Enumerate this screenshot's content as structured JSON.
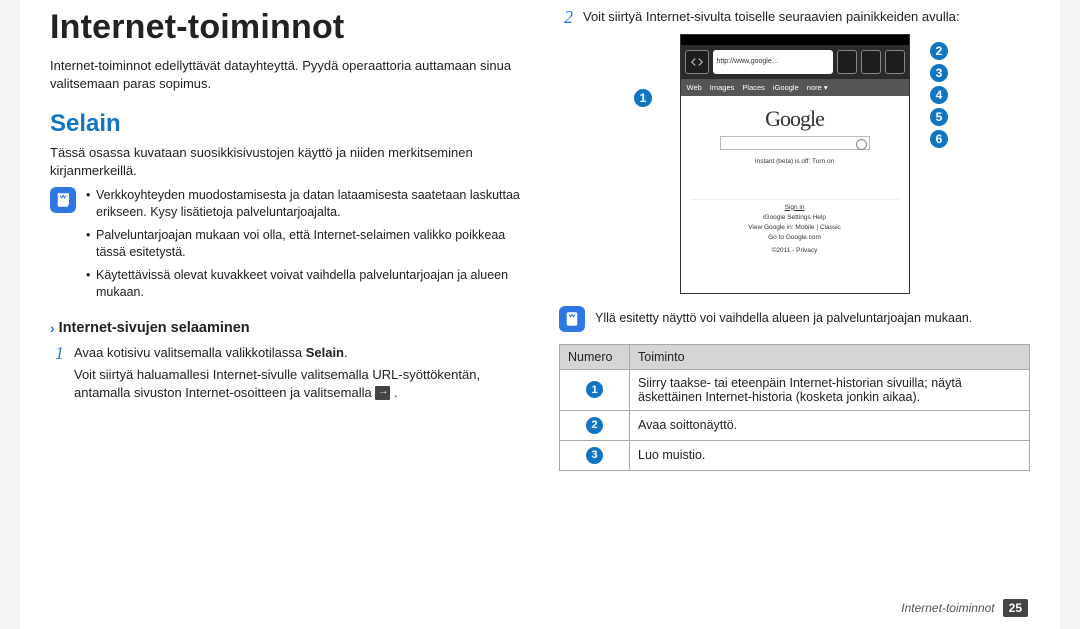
{
  "title": "Internet-toiminnot",
  "intro": "Internet-toiminnot edellyttävät datayhteyttä. Pyydä operaattoria auttamaan sinua valitsemaan paras sopimus.",
  "section_heading": "Selain",
  "section_intro": "Tässä osassa kuvataan suosikkisivustojen käyttö ja niiden merkitseminen kirjanmerkeillä.",
  "note1_items": [
    "Verkkoyhteyden muodostamisesta ja datan lataamisesta saatetaan laskuttaa erikseen. Kysy lisätietoja palveluntarjoajalta.",
    "Palveluntarjoajan mukaan voi olla, että Internet-selaimen valikko poikkeaa tässä esitetystä.",
    "Käytettävissä olevat kuvakkeet voivat vaihdella palveluntarjoajan ja alueen mukaan."
  ],
  "subhead": "Internet-sivujen selaaminen",
  "step1_a": "Avaa kotisivu valitsemalla valikkotilassa ",
  "step1_bold": "Selain",
  "step1_tail": ".",
  "step1_b": "Voit siirtyä haluamallesi Internet-sivulle valitsemalla URL-syöttökentän, antamalla sivuston Internet-osoitteen ja valitsemalla ",
  "step2": "Voit siirtyä Internet-sivulta toiselle seuraavien painikkeiden avulla:",
  "phone": {
    "url": "http://www.google…",
    "tabs": [
      "Web",
      "Images",
      "Places",
      "iGoogle",
      "nore ▾"
    ],
    "logo": "Google",
    "instant": "Instant (beta) is off: Turn on",
    "signin": "Sign in",
    "links": "iGoogle   Settings   Help",
    "view": "View Google in: Mobile | Classic",
    "goto": "Go to Google.com",
    "copy": "©2011 - Privacy"
  },
  "note2": "Yllä esitetty näyttö voi vaihdella alueen ja palveluntarjoajan mukaan.",
  "table": {
    "h1": "Numero",
    "h2": "Toiminto",
    "rows": [
      {
        "n": "1",
        "t": "Siirry taakse- tai eteenpäin Internet-historian sivuilla; näytä äskettäinen Internet-historia (kosketa jonkin aikaa)."
      },
      {
        "n": "2",
        "t": "Avaa soittonäyttö."
      },
      {
        "n": "3",
        "t": "Luo muistio."
      }
    ]
  },
  "footer_label": "Internet-toiminnot",
  "footer_page": "25"
}
